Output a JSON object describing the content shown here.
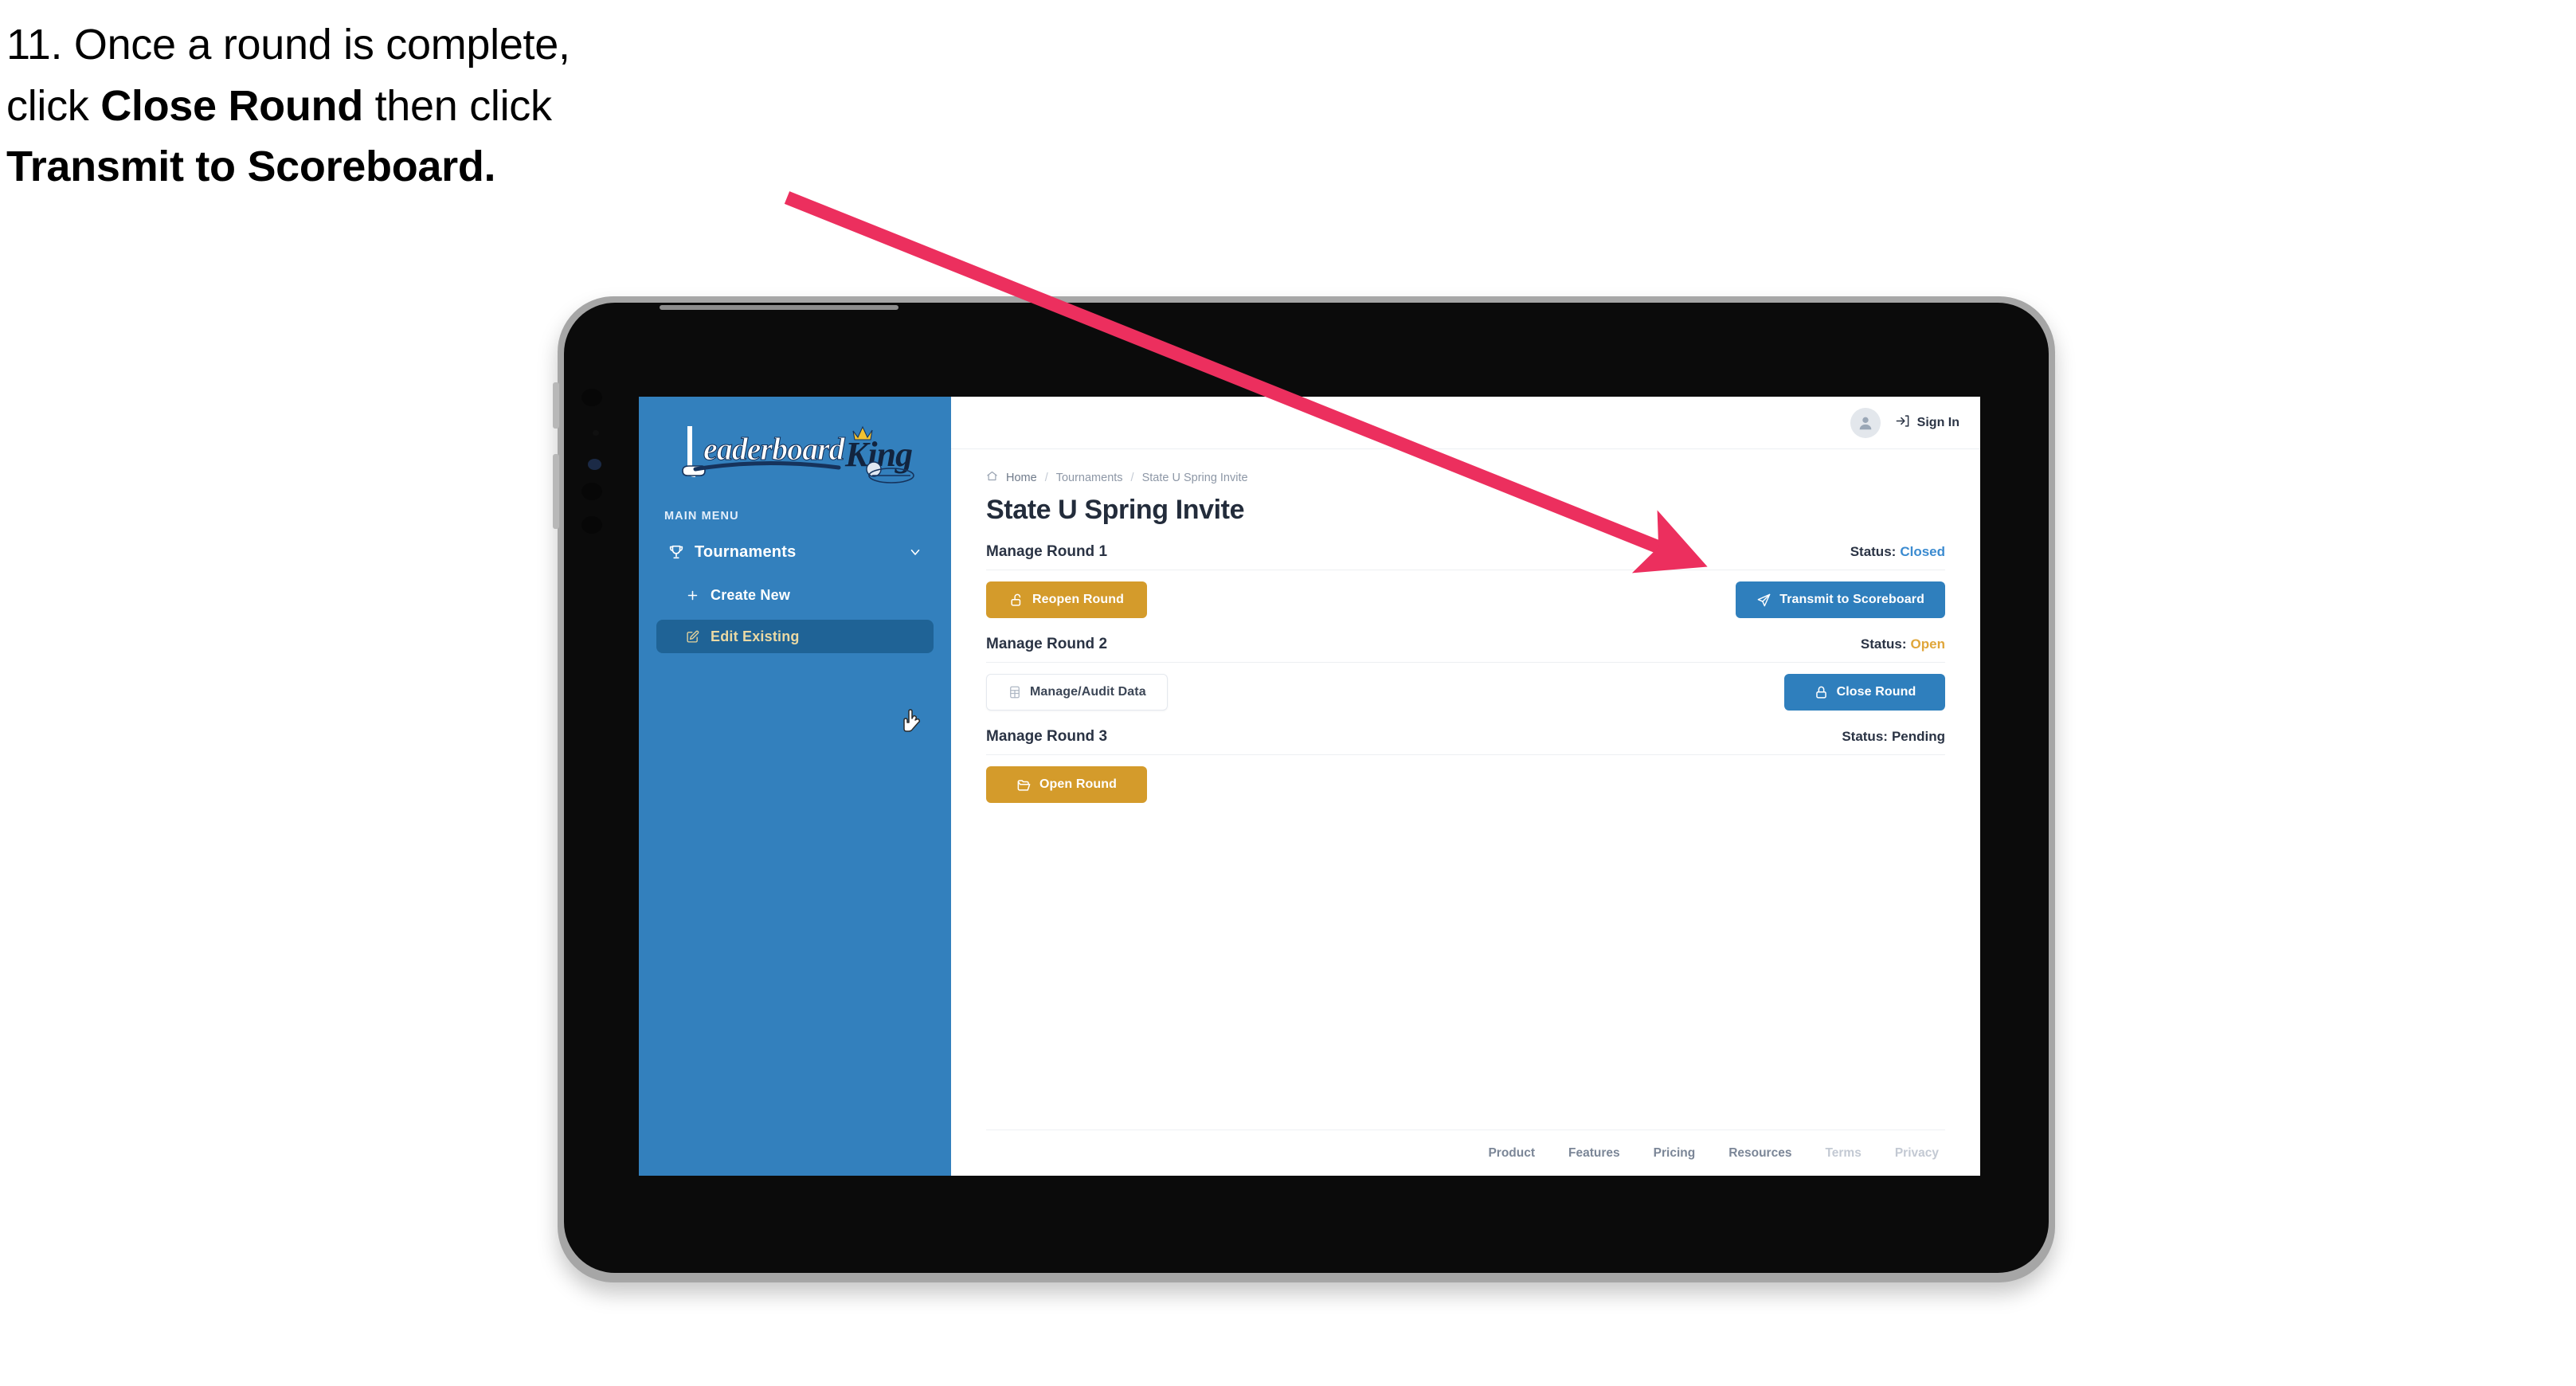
{
  "caption": {
    "line1_prefix": "11. Once a round is complete,",
    "line2_pre": "click ",
    "line2_bold": "Close Round",
    "line2_post": " then click",
    "line3_bold": "Transmit to Scoreboard."
  },
  "colors": {
    "sidebar_blue": "#3380bd",
    "sidebar_active": "#1f6396",
    "accent_amber": "#d49b2b",
    "accent_blue": "#2f7fbd",
    "status_closed": "#3b8bd0",
    "status_open": "#e0a63a",
    "annotation_pink": "#ec2f5e",
    "title_navy": "#232c3b"
  },
  "sidebar": {
    "logo_main": "Leaderboard",
    "logo_accent": "King",
    "section_label": "MAIN MENU",
    "items": [
      {
        "label": "Tournaments",
        "icon": "trophy-icon",
        "chevron": "chevron-down-icon",
        "active": false
      },
      {
        "label": "Create New",
        "icon": "plus-icon",
        "active": false
      },
      {
        "label": "Edit Existing",
        "icon": "edit-square-icon",
        "active": true
      }
    ]
  },
  "topbar": {
    "avatar_icon": "user-avatar-icon",
    "signin_icon": "login-arrow-icon",
    "signin_label": "Sign In"
  },
  "breadcrumb": {
    "home_icon": "home-icon",
    "items": [
      "Home",
      "Tournaments",
      "State U Spring Invite"
    ],
    "separator": "/"
  },
  "page": {
    "title": "State U Spring Invite"
  },
  "rounds": [
    {
      "name": "Manage Round 1",
      "status_label": "Status:",
      "status_value": "Closed",
      "status_kind": "closed",
      "left_button": {
        "label": "Reopen Round",
        "icon": "unlock-icon",
        "style": "amber"
      },
      "right_button": {
        "label": "Transmit to Scoreboard",
        "icon": "paper-plane-icon",
        "style": "blue"
      }
    },
    {
      "name": "Manage Round 2",
      "status_label": "Status:",
      "status_value": "Open",
      "status_kind": "open",
      "left_button": {
        "label": "Manage/Audit Data",
        "icon": "table-grid-icon",
        "style": "ghost"
      },
      "right_button": {
        "label": "Close Round",
        "icon": "lock-icon",
        "style": "blue"
      }
    },
    {
      "name": "Manage Round 3",
      "status_label": "Status:",
      "status_value": "Pending",
      "status_kind": "pending",
      "left_button": {
        "label": "Open Round",
        "icon": "folder-open-icon",
        "style": "amber"
      },
      "right_button": null
    }
  ],
  "footer": {
    "links": [
      {
        "label": "Product",
        "muted": false
      },
      {
        "label": "Features",
        "muted": false
      },
      {
        "label": "Pricing",
        "muted": false
      },
      {
        "label": "Resources",
        "muted": false
      },
      {
        "label": "Terms",
        "muted": true
      },
      {
        "label": "Privacy",
        "muted": true
      }
    ]
  },
  "annotation": {
    "type": "arrow",
    "points_to": "Transmit to Scoreboard",
    "color": "#ec2f5e"
  }
}
